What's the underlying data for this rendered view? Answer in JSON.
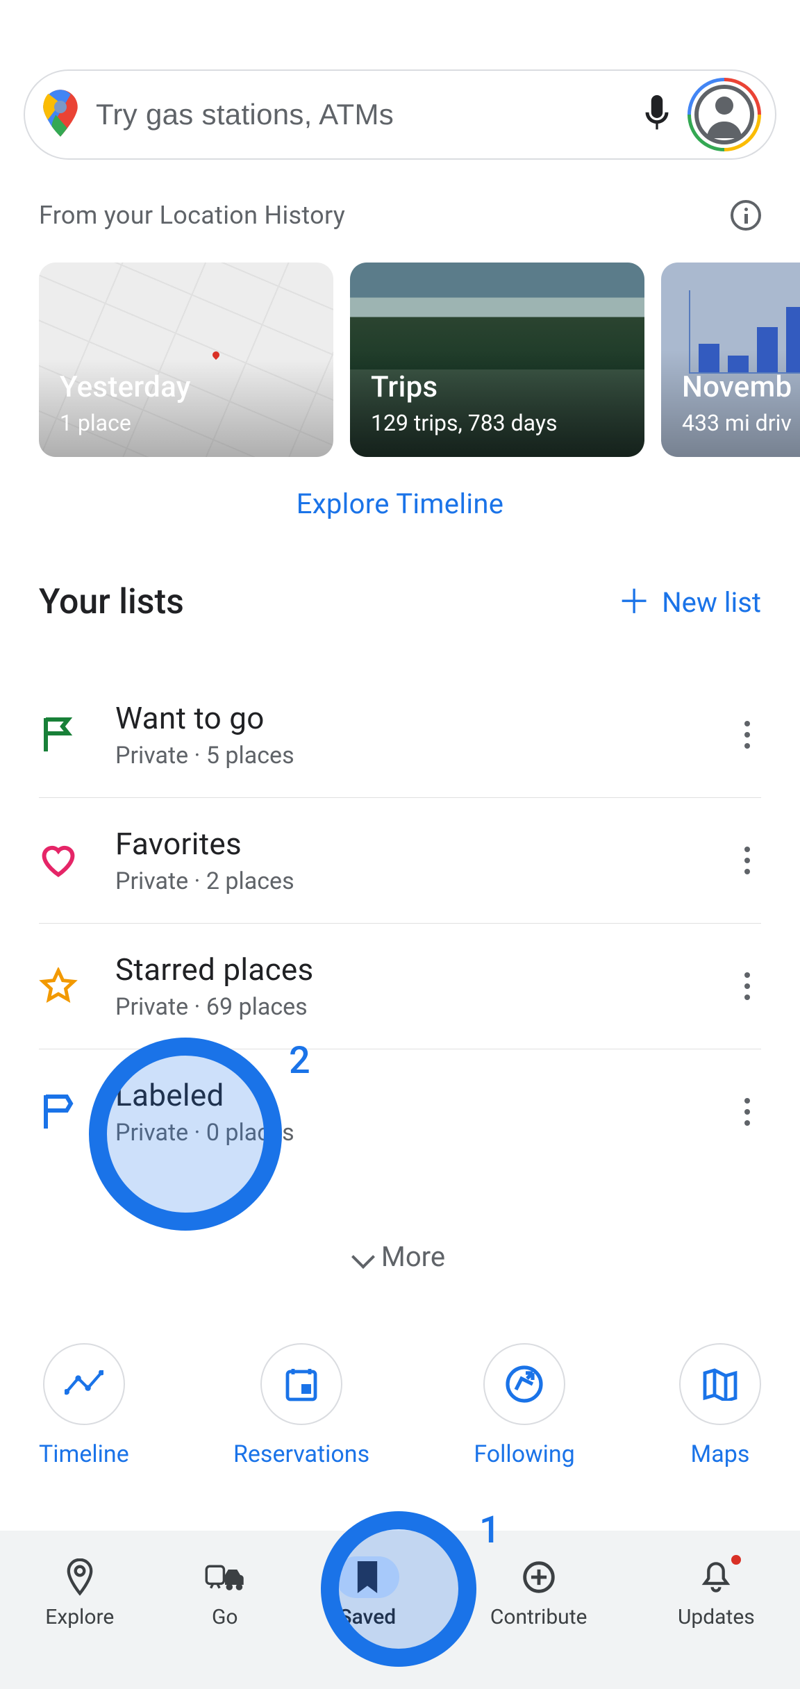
{
  "search": {
    "placeholder": "Try gas stations, ATMs"
  },
  "location_history_caption": "From your Location History",
  "timeline_cards": [
    {
      "title": "Yesterday",
      "sub": "1 place"
    },
    {
      "title": "Trips",
      "sub": "129 trips,  783 days"
    },
    {
      "title": "Novemb",
      "sub": "433 mi driv"
    }
  ],
  "explore_timeline_label": "Explore Timeline",
  "your_lists_title": "Your lists",
  "new_list_label": "New list",
  "lists": [
    {
      "icon": "flag-green",
      "title": "Want to go",
      "sub": "Private · 5 places"
    },
    {
      "icon": "heart-pink",
      "title": "Favorites",
      "sub": "Private · 2 places"
    },
    {
      "icon": "star-orange",
      "title": "Starred places",
      "sub": "Private · 69 places"
    },
    {
      "icon": "flag-blue",
      "title": "Labeled",
      "sub": "Private · 0 places"
    }
  ],
  "more_label": "More",
  "shortcuts": [
    {
      "icon": "timeline",
      "label": "Timeline"
    },
    {
      "icon": "reservations",
      "label": "Reservations"
    },
    {
      "icon": "following",
      "label": "Following"
    },
    {
      "icon": "maps",
      "label": "Maps"
    }
  ],
  "bottom_nav": [
    {
      "icon": "explore-pin",
      "label": "Explore",
      "active": false
    },
    {
      "icon": "go",
      "label": "Go",
      "active": false
    },
    {
      "icon": "saved",
      "label": "Saved",
      "active": true
    },
    {
      "icon": "contribute",
      "label": "Contribute",
      "active": false
    },
    {
      "icon": "updates",
      "label": "Updates",
      "active": false,
      "dot": true
    }
  ],
  "hints": {
    "1": "1",
    "2": "2"
  }
}
